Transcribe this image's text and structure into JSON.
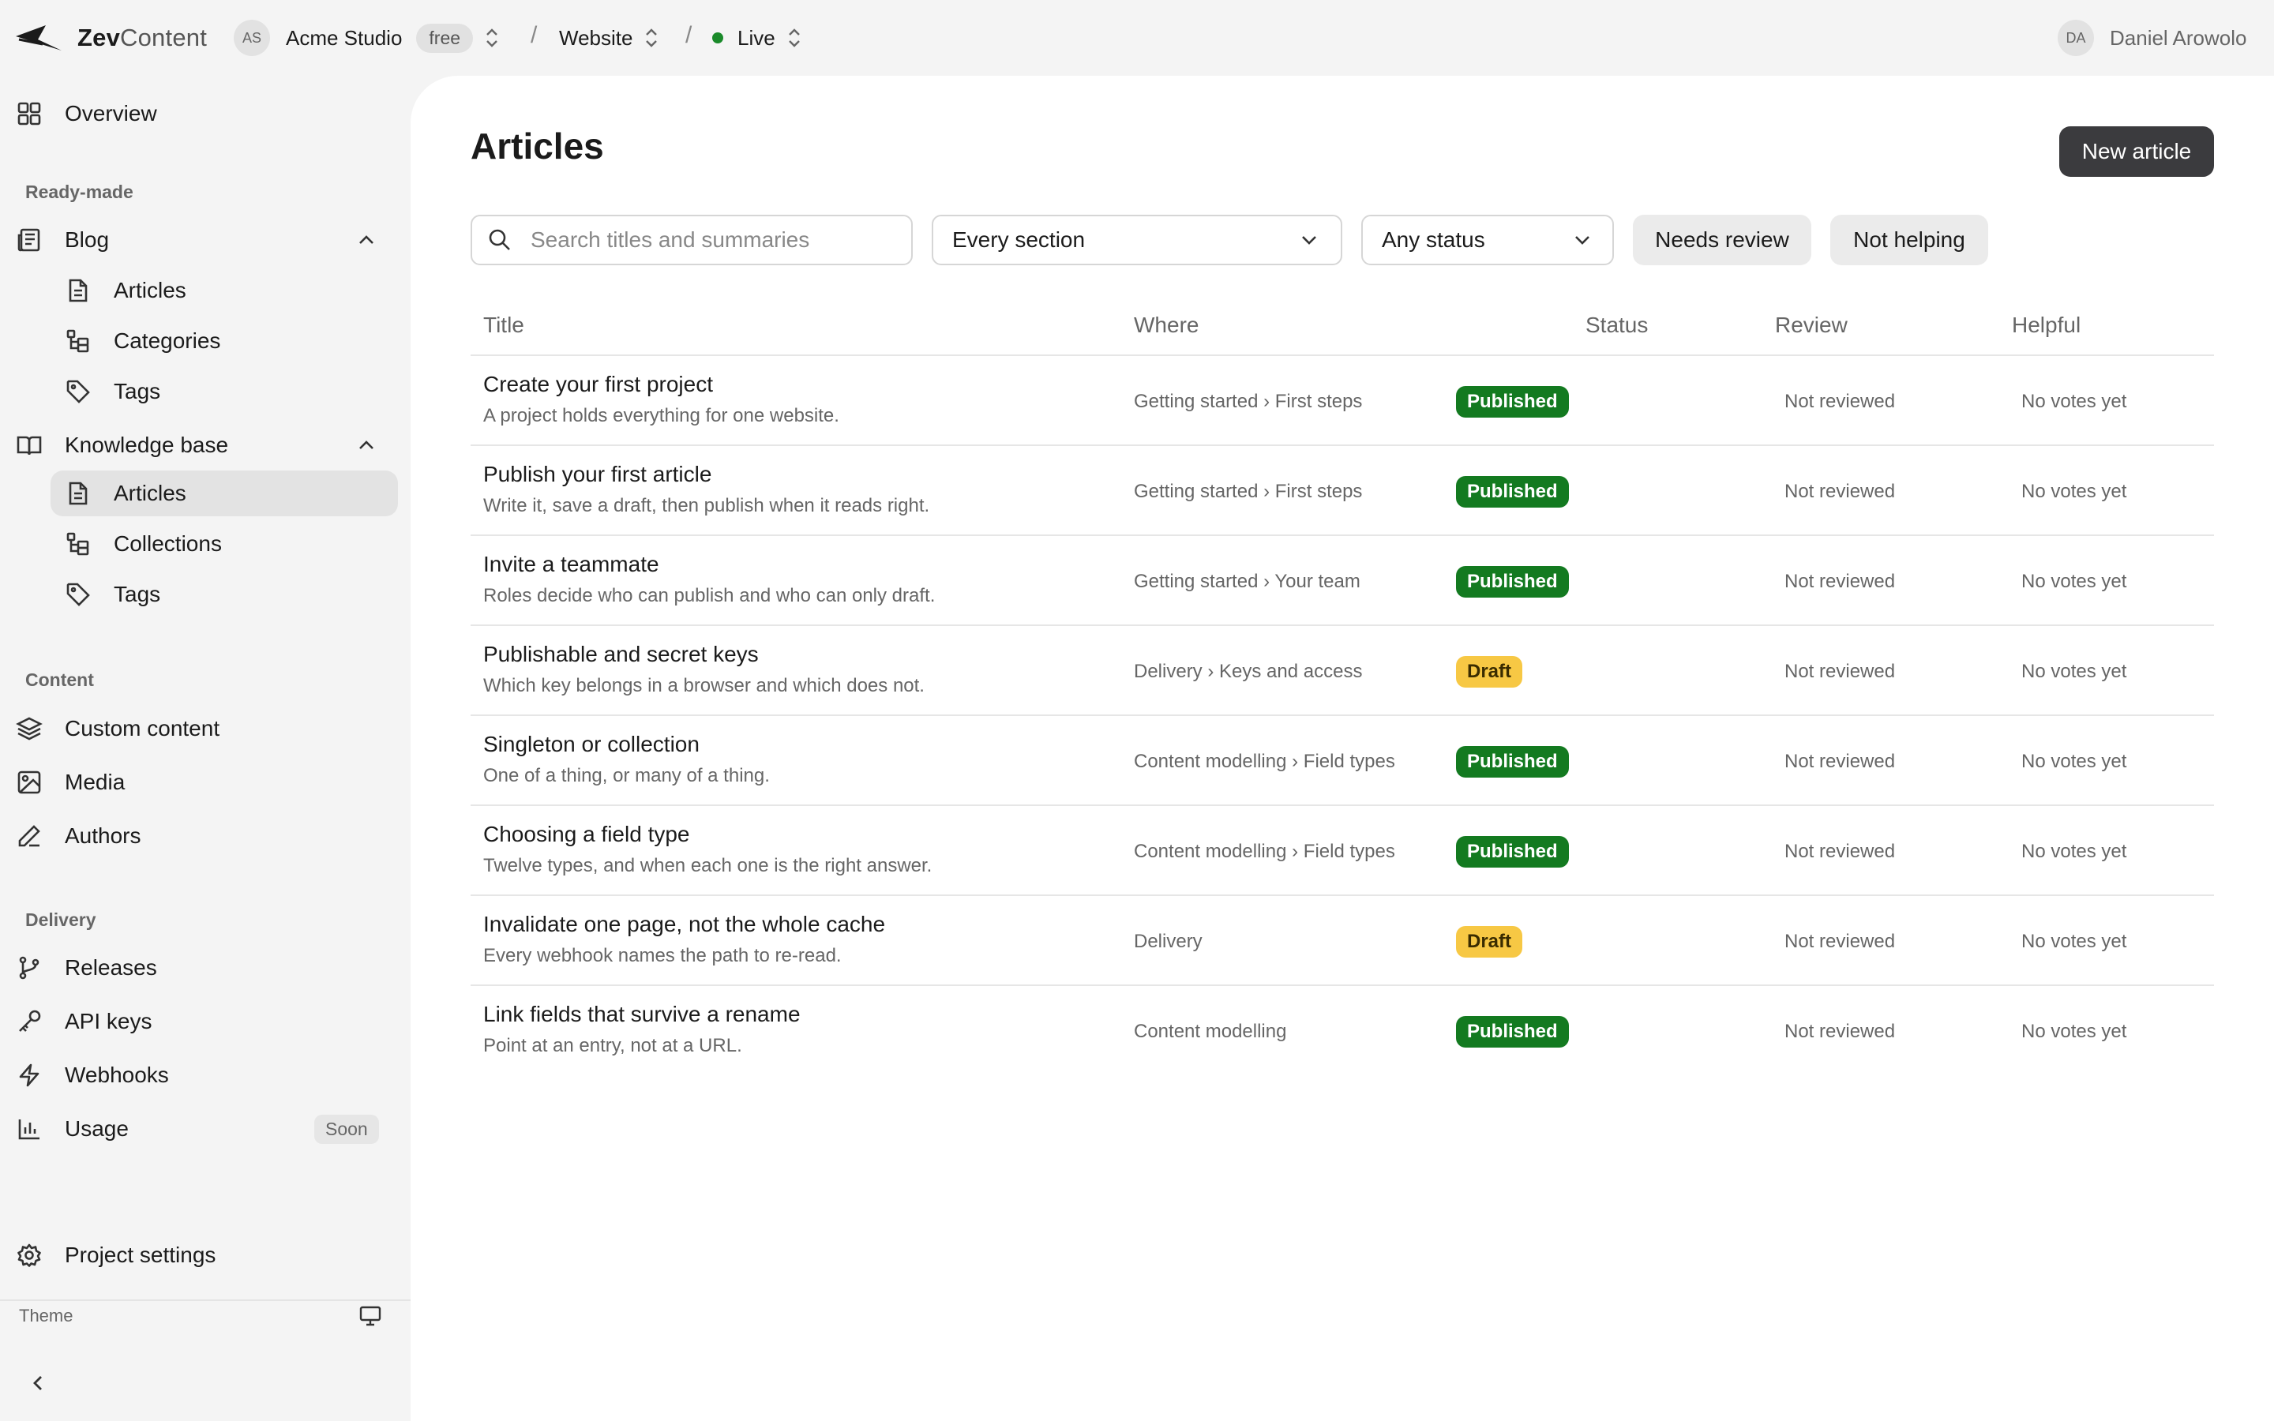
{
  "app": {
    "logo_brand": "Zev",
    "logo_suffix": "Content"
  },
  "breadcrumb": {
    "org_initials": "AS",
    "org_name": "Acme Studio",
    "org_plan": "free",
    "project": "Website",
    "environment": "Live"
  },
  "user": {
    "initials": "DA",
    "name": "Daniel Arowolo"
  },
  "sidebar": {
    "overview": "Overview",
    "readymade_heading": "Ready-made",
    "blog": {
      "label": "Blog",
      "articles": "Articles",
      "categories": "Categories",
      "tags": "Tags"
    },
    "kb": {
      "label": "Knowledge base",
      "articles": "Articles",
      "collections": "Collections",
      "tags": "Tags"
    },
    "content_heading": "Content",
    "custom_content": "Custom content",
    "media": "Media",
    "authors": "Authors",
    "delivery_heading": "Delivery",
    "releases": "Releases",
    "api_keys": "API keys",
    "webhooks": "Webhooks",
    "usage": "Usage",
    "usage_badge": "Soon",
    "project_settings": "Project settings",
    "theme": "Theme"
  },
  "page": {
    "title": "Articles",
    "new_button": "New article",
    "search_placeholder": "Search titles and summaries",
    "section_filter": "Every section",
    "status_filter": "Any status",
    "chip_review": "Needs review",
    "chip_helping": "Not helping"
  },
  "table": {
    "headers": {
      "title": "Title",
      "where": "Where",
      "status": "Status",
      "review": "Review",
      "helpful": "Helpful"
    },
    "rows": [
      {
        "title": "Create your first project",
        "summary": "A project holds everything for one website.",
        "where": "Getting started › First steps",
        "status": "Published",
        "review": "Not reviewed",
        "helpful": "No votes yet"
      },
      {
        "title": "Publish your first article",
        "summary": "Write it, save a draft, then publish when it reads right.",
        "where": "Getting started › First steps",
        "status": "Published",
        "review": "Not reviewed",
        "helpful": "No votes yet"
      },
      {
        "title": "Invite a teammate",
        "summary": "Roles decide who can publish and who can only draft.",
        "where": "Getting started › Your team",
        "status": "Published",
        "review": "Not reviewed",
        "helpful": "No votes yet"
      },
      {
        "title": "Publishable and secret keys",
        "summary": "Which key belongs in a browser and which does not.",
        "where": "Delivery › Keys and access",
        "status": "Draft",
        "review": "Not reviewed",
        "helpful": "No votes yet"
      },
      {
        "title": "Singleton or collection",
        "summary": "One of a thing, or many of a thing.",
        "where": "Content modelling › Field types",
        "status": "Published",
        "review": "Not reviewed",
        "helpful": "No votes yet"
      },
      {
        "title": "Choosing a field type",
        "summary": "Twelve types, and when each one is the right answer.",
        "where": "Content modelling › Field types",
        "status": "Published",
        "review": "Not reviewed",
        "helpful": "No votes yet"
      },
      {
        "title": "Invalidate one page, not the whole cache",
        "summary": "Every webhook names the path to re-read.",
        "where": "Delivery",
        "status": "Draft",
        "review": "Not reviewed",
        "helpful": "No votes yet"
      },
      {
        "title": "Link fields that survive a rename",
        "summary": "Point at an entry, not at a URL.",
        "where": "Content modelling",
        "status": "Published",
        "review": "Not reviewed",
        "helpful": "No votes yet"
      }
    ]
  },
  "colors": {
    "published": "#137a20",
    "draft": "#f7c844",
    "live": "#1a8a2a",
    "primary_button": "#3b3b3e"
  }
}
